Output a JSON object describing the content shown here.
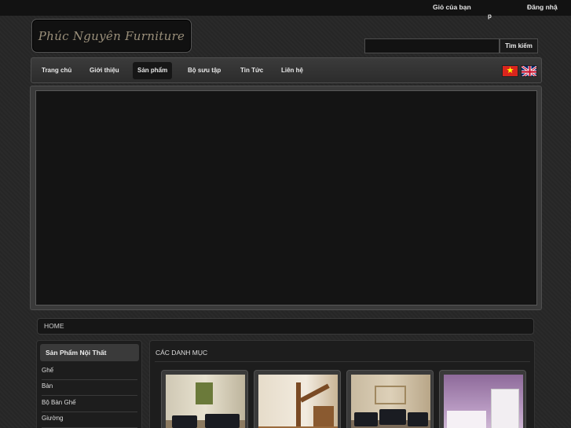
{
  "topbar": {
    "cart_label": "Giỏ của bạn",
    "login_label": "Đăng nhậ",
    "login_fragment": "p"
  },
  "header": {
    "logo_text": "Phúc Nguyên Furniture"
  },
  "search": {
    "value": "",
    "placeholder": "",
    "button_label": "Tìm kiếm"
  },
  "nav": {
    "items": [
      {
        "label": "Trang chủ",
        "active": false
      },
      {
        "label": "Giới thiệu",
        "active": false
      },
      {
        "label": "Sản phẩm",
        "active": true
      },
      {
        "label": "Bộ sưu tập",
        "active": false
      },
      {
        "label": "Tin Tức",
        "active": false
      },
      {
        "label": "Liên hệ",
        "active": false
      }
    ],
    "flags": [
      "vietnam-flag-icon",
      "uk-flag-icon"
    ]
  },
  "breadcrumb": {
    "home_label": "HOME"
  },
  "sidebar": {
    "title": "Sản Phẩm Nội Thất",
    "items": [
      {
        "label": "Ghế"
      },
      {
        "label": "Bàn"
      },
      {
        "label": "Bộ Bàn Ghế"
      },
      {
        "label": "Giường"
      }
    ]
  },
  "main": {
    "title": "CÁC DANH MỤC",
    "products": [
      {
        "image": "sofa-room-photo"
      },
      {
        "image": "staircase-photo"
      },
      {
        "image": "leather-sofa-photo"
      },
      {
        "image": "bedroom-set-photo"
      }
    ]
  },
  "colors": {
    "background": "#262626",
    "topbar": "#121212",
    "panel": "#1d1d1d",
    "active_nav": "#161616",
    "text": "#e8e8e8"
  }
}
